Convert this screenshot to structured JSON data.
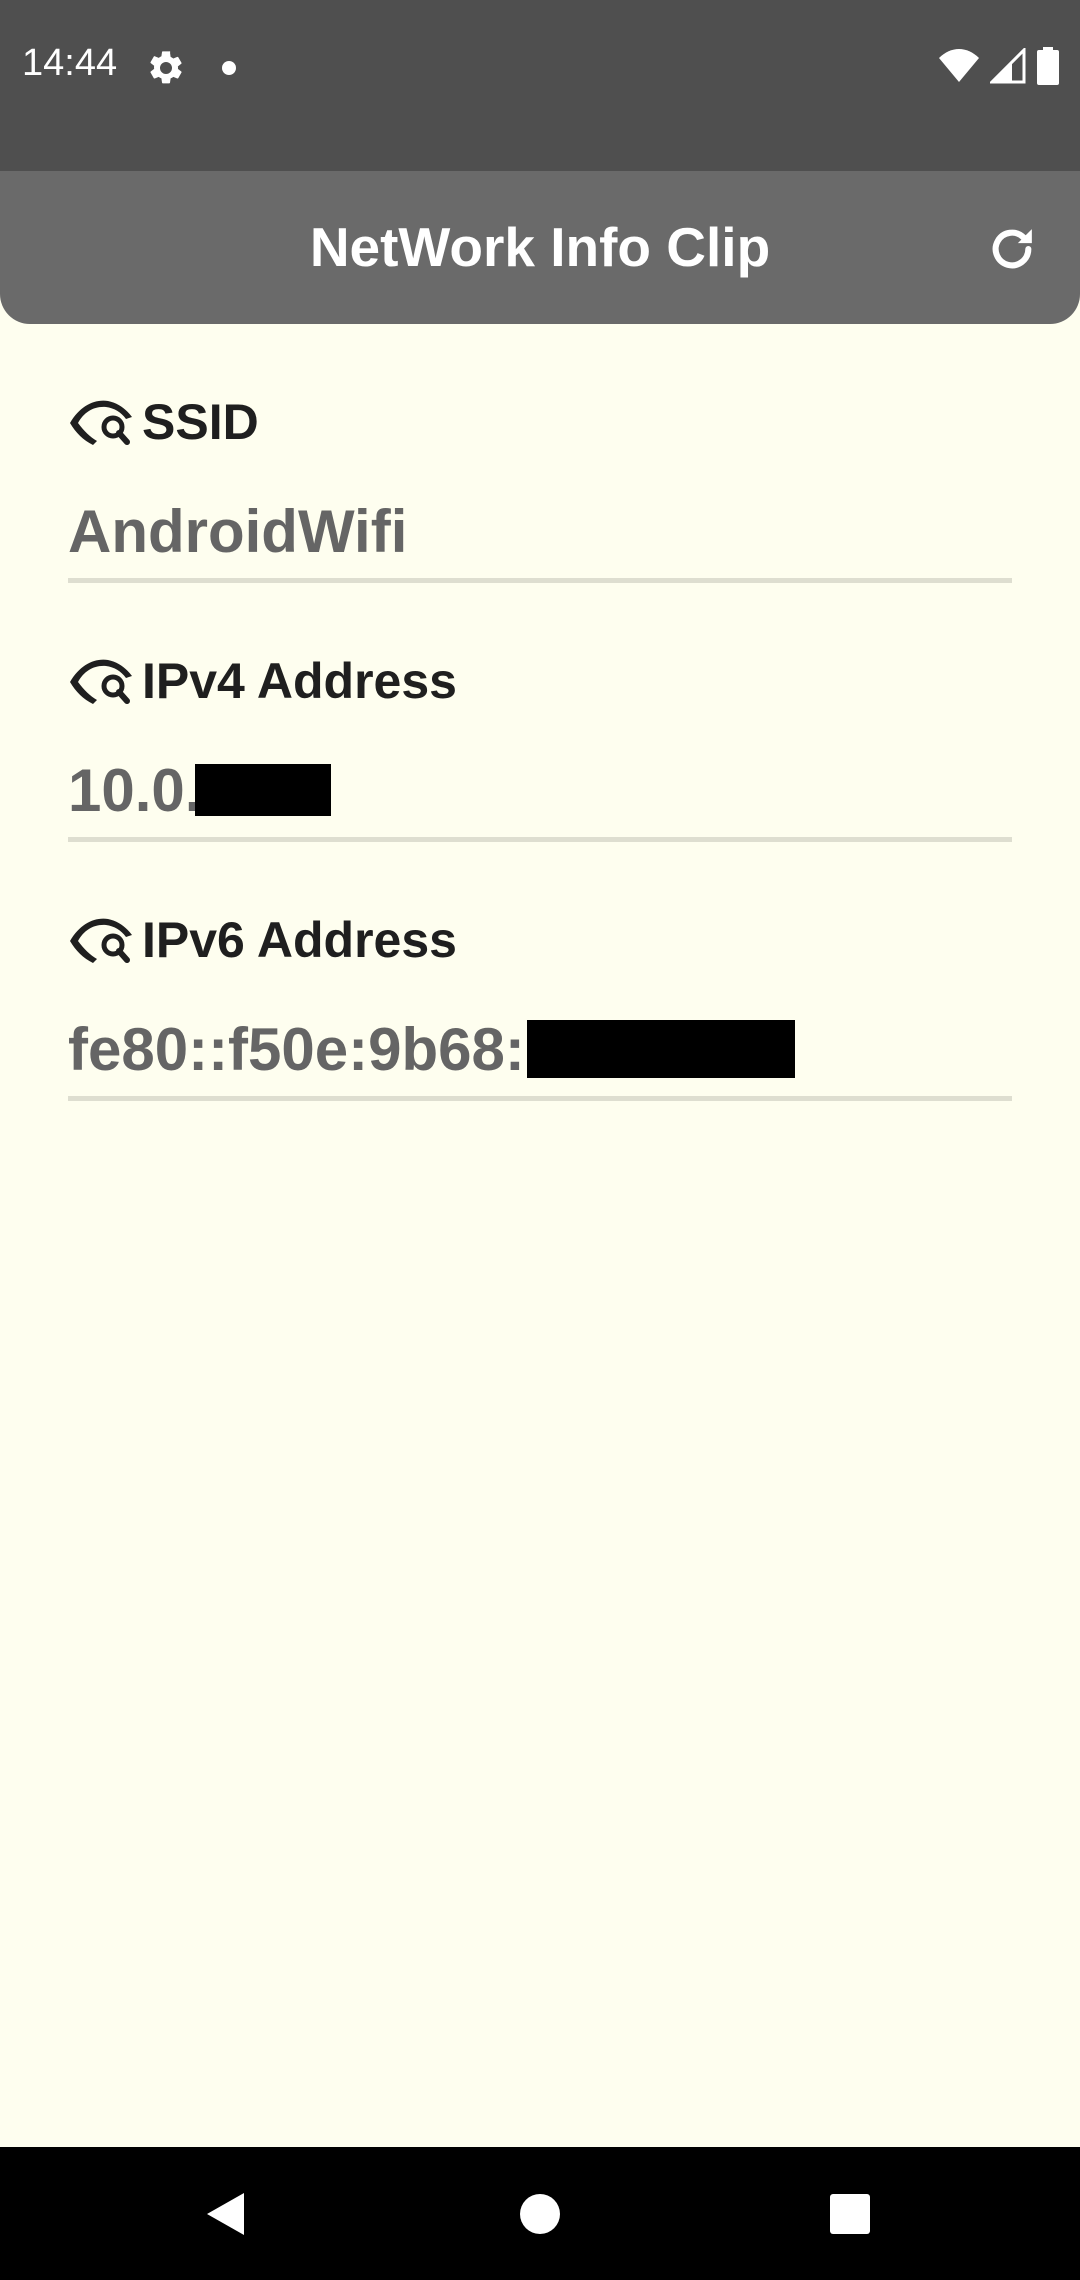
{
  "status_bar": {
    "time": "14:44",
    "icons": [
      "settings-icon",
      "notification-dot-icon",
      "wifi-icon",
      "cellular-signal-icon",
      "battery-icon"
    ]
  },
  "app_bar": {
    "title": "NetWork Info Clip",
    "refresh_icon": "refresh-icon"
  },
  "items": [
    {
      "label": "SSID",
      "value": "AndroidWifi",
      "redacted": false
    },
    {
      "label": "IPv4 Address",
      "value": "10.0.",
      "redacted": true
    },
    {
      "label": "IPv6 Address",
      "value": "fe80::f50e:9b68:",
      "redacted": true
    }
  ],
  "nav_bar": {
    "buttons": [
      "back-icon",
      "home-icon",
      "recents-icon"
    ]
  },
  "colors": {
    "status_bar": "#4F4F4F",
    "app_bar": "#6A6A6A",
    "background": "#FEFEEF",
    "label_text": "#1F1F1F",
    "value_text": "#656565",
    "divider": "#DEDED0"
  }
}
